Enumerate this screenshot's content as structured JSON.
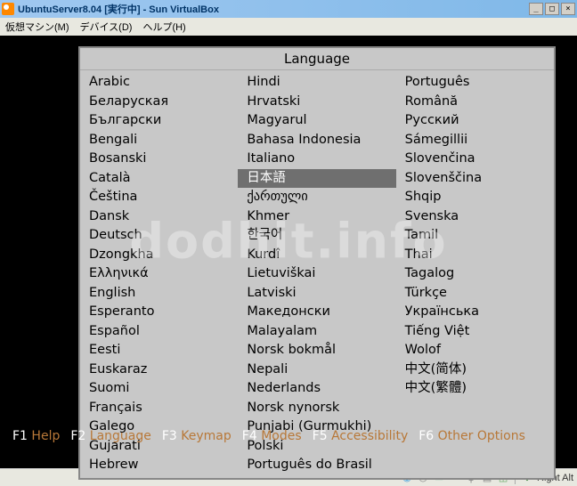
{
  "window": {
    "title": "UbuntuServer8.04 [実行中] - Sun VirtualBox",
    "buttons": {
      "min": "_",
      "max": "□",
      "close": "×"
    }
  },
  "menubar": {
    "machine": "仮想マシン(M)",
    "device": "デバイス(D)",
    "help": "ヘルプ(H)"
  },
  "watermark": "dodhit.info",
  "language_panel": {
    "title": "Language",
    "selected": "日本語",
    "col1": [
      "Arabic",
      "Беларуская",
      "Български",
      "Bengali",
      "Bosanski",
      "Català",
      "Čeština",
      "Dansk",
      "Deutsch",
      "Dzongkha",
      "Ελληνικά",
      "English",
      "Esperanto",
      "Español",
      "Eesti",
      "Euskaraz",
      "Suomi",
      "Français",
      "Galego",
      "Gujarati",
      "Hebrew"
    ],
    "col2": [
      "Hindi",
      "Hrvatski",
      "Magyarul",
      "Bahasa Indonesia",
      "Italiano",
      "日本語",
      "ქართული",
      "Khmer",
      "한국어",
      "Kurdî",
      "Lietuviškai",
      "Latviski",
      "Македонски",
      "Malayalam",
      "Norsk bokmål",
      "Nepali",
      "Nederlands",
      "Norsk nynorsk",
      "Punjabi (Gurmukhi)",
      "Polski",
      "Português do Brasil"
    ],
    "col3": [
      "Português",
      "Română",
      "Русский",
      "Sámegillii",
      "Slovenčina",
      "Slovenščina",
      "Shqip",
      "Svenska",
      "Tamil",
      "Thai",
      "Tagalog",
      "Türkçe",
      "Українська",
      "Tiếng Việt",
      "Wolof",
      "中文(简体)",
      "中文(繁體)"
    ]
  },
  "fkeys": [
    {
      "key": "F1",
      "label": "Help"
    },
    {
      "key": "F2",
      "label": "Language"
    },
    {
      "key": "F3",
      "label": "Keymap"
    },
    {
      "key": "F4",
      "label": "Modes"
    },
    {
      "key": "F5",
      "label": "Accessibility"
    },
    {
      "key": "F6",
      "label": "Other Options"
    }
  ],
  "statusbar": {
    "icons": [
      "globe",
      "disc",
      "disk",
      "net",
      "usb",
      "share",
      "mouse"
    ],
    "hostkey_icon": "⬇",
    "hostkey": "Right Alt"
  }
}
